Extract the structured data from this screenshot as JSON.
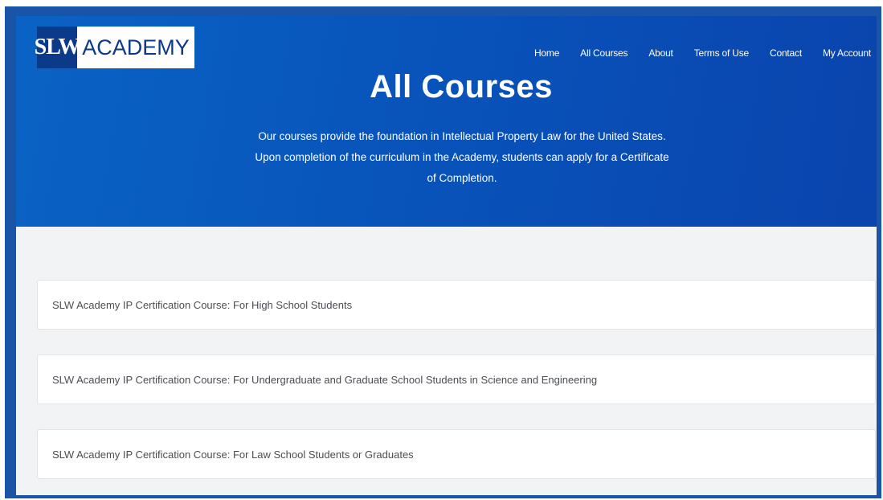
{
  "logo": {
    "part1": "SLW",
    "part2": "ACADEMY"
  },
  "nav": {
    "items": [
      {
        "label": "Home"
      },
      {
        "label": "All Courses"
      },
      {
        "label": "About"
      },
      {
        "label": "Terms of Use"
      },
      {
        "label": "Contact"
      },
      {
        "label": "My Account"
      }
    ]
  },
  "hero": {
    "title": "All Courses",
    "description": "Our courses provide the foundation in Intellectual Property Law for the United States. Upon completion of the curriculum in the Academy, students can apply for a Certificate of Completion."
  },
  "courses": [
    {
      "title": "SLW Academy IP Certification Course: For High School Students"
    },
    {
      "title": "SLW Academy IP Certification Course: For Undergraduate and Graduate School Students in Science and Engineering"
    },
    {
      "title": "SLW Academy IP Certification Course: For Law School Students or Graduates"
    }
  ],
  "colors": {
    "frame": "#1a54a7",
    "hero_start": "#0a63c4",
    "hero_end": "#0a44ad",
    "logo_dark": "#0b3a8a",
    "background": "#f2f3f4",
    "card": "#ffffff",
    "card_text": "#4a4d52"
  }
}
